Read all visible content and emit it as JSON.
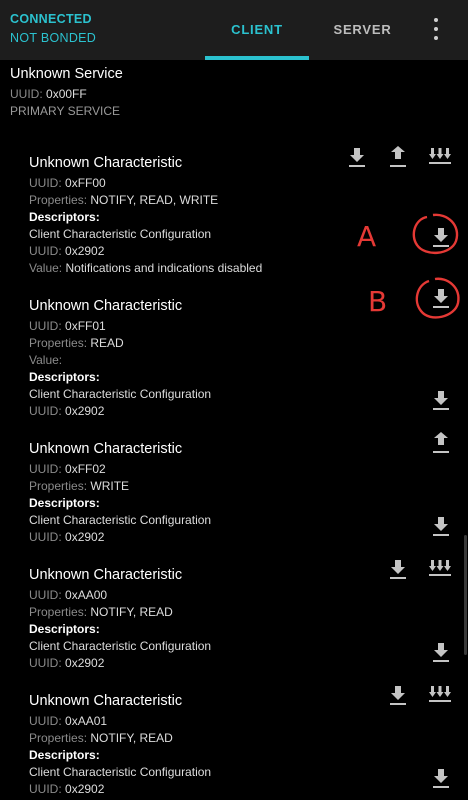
{
  "status": {
    "connected": "CONNECTED",
    "bond": "NOT BONDED"
  },
  "tabs": {
    "client": "CLIENT",
    "server": "SERVER"
  },
  "service": {
    "name": "Unknown Service",
    "uuid_label": "UUID:",
    "uuid": "0x00FF",
    "type": "PRIMARY SERVICE"
  },
  "labels": {
    "uuid": "UUID:",
    "properties": "Properties:",
    "value": "Value:",
    "descriptors": "Descriptors:"
  },
  "characteristics": [
    {
      "name": "Unknown Characteristic",
      "uuid": "0xFF00",
      "properties": "NOTIFY, READ, WRITE",
      "descriptor": {
        "name": "Client Characteristic Configuration",
        "uuid": "0x2902",
        "value": "Notifications and indications disabled"
      }
    },
    {
      "name": "Unknown Characteristic",
      "uuid": "0xFF01",
      "properties": "READ",
      "value": "",
      "descriptor": {
        "name": "Client Characteristic Configuration",
        "uuid": "0x2902"
      }
    },
    {
      "name": "Unknown Characteristic",
      "uuid": "0xFF02",
      "properties": "WRITE",
      "descriptor": {
        "name": "Client Characteristic Configuration",
        "uuid": "0x2902"
      }
    },
    {
      "name": "Unknown Characteristic",
      "uuid": "0xAA00",
      "properties": "NOTIFY, READ",
      "descriptor": {
        "name": "Client Characteristic Configuration",
        "uuid": "0x2902"
      }
    },
    {
      "name": "Unknown Characteristic",
      "uuid": "0xAA01",
      "properties": "NOTIFY, READ",
      "descriptor": {
        "name": "Client Characteristic Configuration",
        "uuid": "0x2902"
      }
    }
  ],
  "annotations": {
    "a": "A",
    "b": "B"
  },
  "icons": {
    "read": "download-icon",
    "write": "upload-icon",
    "notify": "multi-download-icon",
    "menu": "more-vert-icon"
  },
  "colors": {
    "accent": "#2bc2cf",
    "annotation": "#e53935",
    "background": "#000000",
    "toolbar": "#1d1d1d"
  }
}
